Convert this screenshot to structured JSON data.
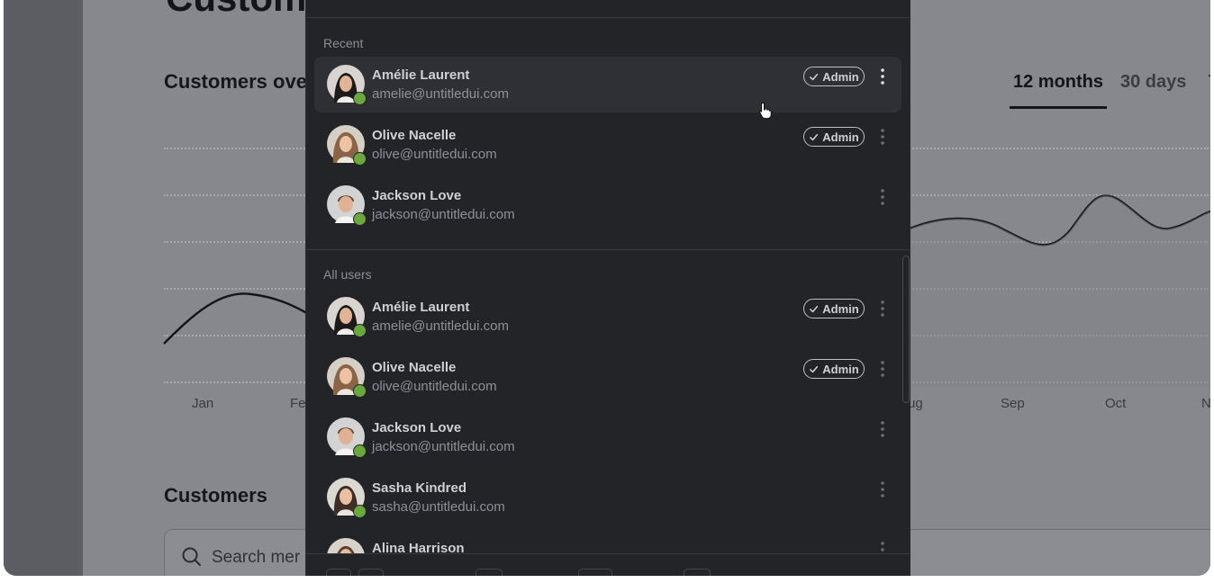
{
  "background": {
    "page_title": "Custom",
    "chart_title": "Customers ove",
    "tabs": [
      "12 months",
      "30 days",
      "7"
    ],
    "months_visible": [
      "Jan",
      "Fe",
      "ug",
      "Sep",
      "Oct",
      "N"
    ],
    "section_title": "Customers",
    "search_placeholder": "Search mer"
  },
  "dropdown": {
    "recent_label": "Recent",
    "all_users_label": "All users",
    "admin_label": "Admin",
    "recent": [
      {
        "name": "Amélie Laurent",
        "email": "amelie@untitledui.com",
        "admin": true
      },
      {
        "name": "Olive Nacelle",
        "email": "olive@untitledui.com",
        "admin": true
      },
      {
        "name": "Jackson Love",
        "email": "jackson@untitledui.com",
        "admin": false
      }
    ],
    "all_users": [
      {
        "name": "Amélie Laurent",
        "email": "amelie@untitledui.com",
        "admin": true
      },
      {
        "name": "Olive Nacelle",
        "email": "olive@untitledui.com",
        "admin": true
      },
      {
        "name": "Jackson Love",
        "email": "jackson@untitledui.com",
        "admin": false
      },
      {
        "name": "Sasha Kindred",
        "email": "sasha@untitledui.com",
        "admin": false
      },
      {
        "name": "Alina Harrison",
        "email": "",
        "admin": false
      }
    ]
  },
  "colors": {
    "panel_bg": "#232428",
    "verified_green": "#6aa83b",
    "overlay": "#8e9095"
  }
}
